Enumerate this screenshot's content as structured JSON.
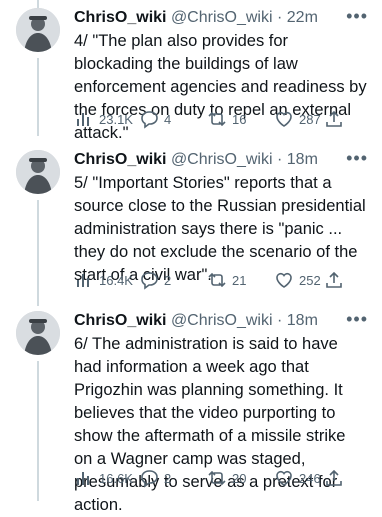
{
  "tweets": [
    {
      "name": "ChrisO_wiki",
      "handle": "@ChrisO_wiki",
      "dot": "·",
      "time": "22m",
      "text": "4/ \"The plan also provides for blockading the buildings of law enforcement agencies and readiness by the forces on duty to repel an external attack.\"",
      "views": "23.1K",
      "replies": "4",
      "retweets": "16",
      "likes": "287"
    },
    {
      "name": "ChrisO_wiki",
      "handle": "@ChrisO_wiki",
      "dot": "·",
      "time": "18m",
      "text": "5/ \"Important Stories\" reports that a source close to the Russian presidential administration says there is \"panic ... they do not exclude the scenario of the start of a civil war\".",
      "views": "16.4K",
      "replies": "2",
      "retweets": "21",
      "likes": "252"
    },
    {
      "name": "ChrisO_wiki",
      "handle": "@ChrisO_wiki",
      "dot": "·",
      "time": "18m",
      "text": "6/ The administration is said to have had information a week ago that Prigozhin was planning something. It believes that the video purporting to show the aftermath of a missile strike on a Wagner camp was staged, presumably to serve as a pretext for action.",
      "views": "16.6K",
      "replies": "2",
      "retweets": "20",
      "likes": "246"
    }
  ],
  "icons": {
    "more": "more-icon",
    "views": "views-icon",
    "reply": "reply-icon",
    "retweet": "retweet-icon",
    "like": "like-icon",
    "share": "share-icon"
  },
  "colors": {
    "text": "#0f1419",
    "secondary": "#536471",
    "thread_line": "#cfd9de"
  }
}
